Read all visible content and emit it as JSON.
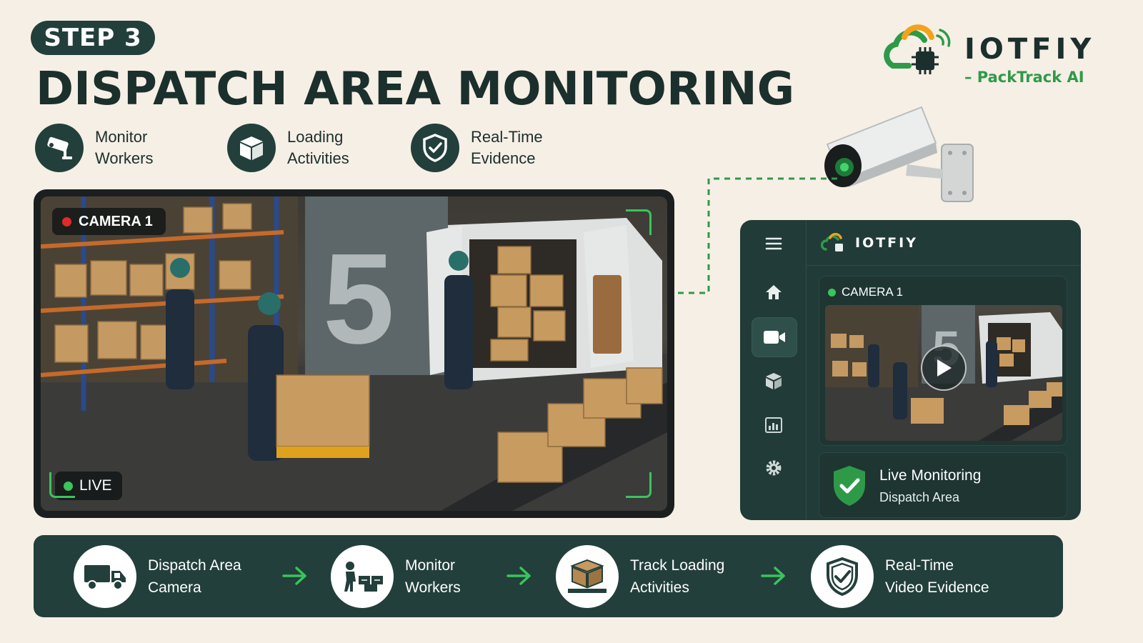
{
  "header": {
    "step_label": "STEP 3",
    "title": "DISPATCH AREA MONITORING"
  },
  "brand": {
    "name": "IOTFIY",
    "subtitle": "– PackTrack AI",
    "logo_icon": "cloud-chip-icon",
    "colors": {
      "green": "#2e9a48",
      "orange": "#f2a31b",
      "dark": "#1b2f2c"
    }
  },
  "features": [
    {
      "line1": "Monitor",
      "line2": "Workers",
      "icon": "cctv-icon"
    },
    {
      "line1": "Loading",
      "line2": "Activities",
      "icon": "box-icon"
    },
    {
      "line1": "Real-Time",
      "line2": "Evidence",
      "icon": "shield-check-icon"
    }
  ],
  "camera_feed": {
    "camera_label": "CAMERA 1",
    "live_label": "LIVE",
    "dock_number": "5"
  },
  "app": {
    "brand_name": "IOTFIY",
    "sidebar": [
      {
        "icon": "menu-icon"
      },
      {
        "icon": "home-icon"
      },
      {
        "icon": "video-camera-icon",
        "active": true
      },
      {
        "icon": "box-icon"
      },
      {
        "icon": "chart-icon"
      },
      {
        "icon": "gear-icon"
      }
    ],
    "camera_card": {
      "title": "CAMERA 1",
      "thumb_dock_number": "5"
    },
    "status": {
      "title": "Live Monitoring",
      "subtitle": "Dispatch Area"
    }
  },
  "flow": [
    {
      "line1": "Dispatch Area",
      "line2": "Camera",
      "icon": "truck-icon"
    },
    {
      "line1": "Monitor",
      "line2": "Workers",
      "icon": "workers-icon"
    },
    {
      "line1": "Track Loading",
      "line2": "Activities",
      "icon": "pallet-boxes-icon"
    },
    {
      "line1": "Real-Time",
      "line2": "Video Evidence",
      "icon": "shield-check-icon"
    }
  ]
}
